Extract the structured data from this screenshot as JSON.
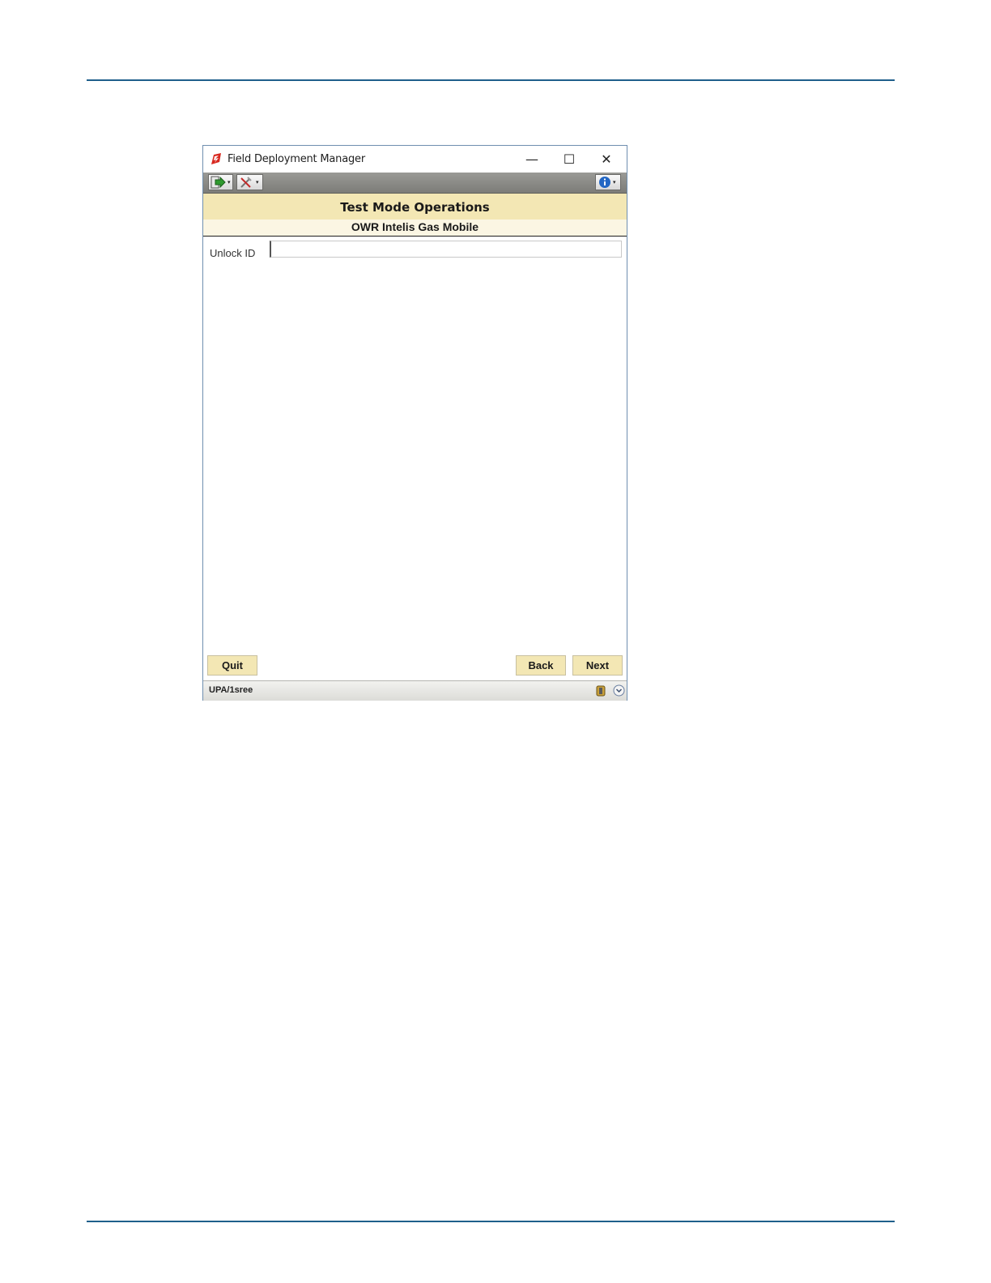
{
  "window": {
    "title": "Field Deployment Manager"
  },
  "window_controls": {
    "minimize": "—",
    "maximize": "☐",
    "close": "✕"
  },
  "toolbar": {
    "exit_icon": "exit-arrow-icon",
    "tools_icon": "tools-icon",
    "info_icon": "info-icon"
  },
  "header": {
    "title": "Test Mode Operations",
    "subtitle": "OWR Intelis Gas Mobile"
  },
  "form": {
    "unlock_label": "Unlock ID",
    "unlock_value": ""
  },
  "buttons": {
    "quit": "Quit",
    "back": "Back",
    "next": "Next"
  },
  "status": {
    "text": "UPA/1sree"
  },
  "colors": {
    "header_bg": "#f3e7b4",
    "button_bg": "#f3e7b4",
    "rule": "#1f5f8b"
  }
}
